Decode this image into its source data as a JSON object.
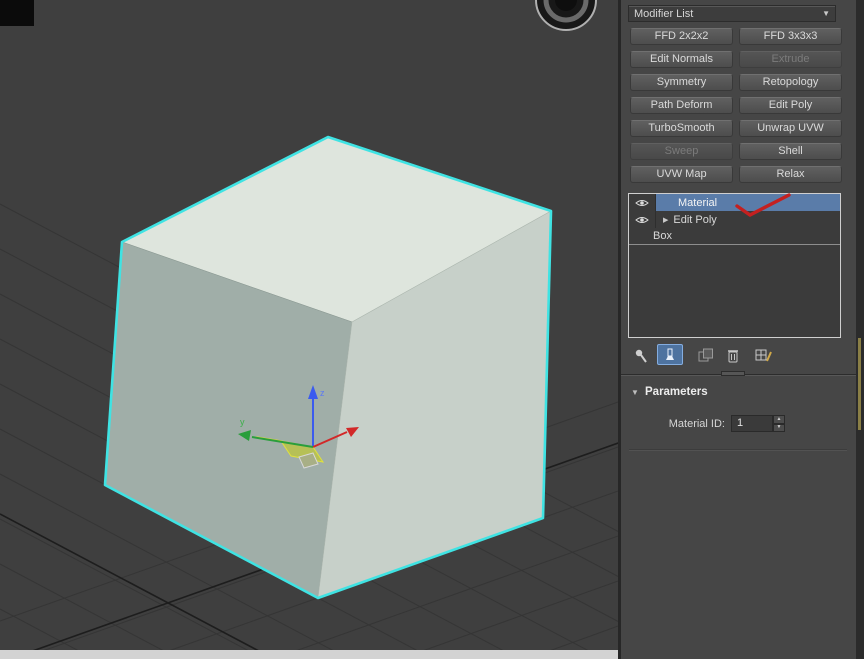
{
  "colors": {
    "selection_outline": "#3fe3e3",
    "stack_selected": "#5a7ca9",
    "annotation_check": "#c42020",
    "axis_x": "#d22828",
    "axis_y": "#2a9e3c",
    "axis_z": "#3b5bee",
    "panel_background": "#464646",
    "viewport_background": "#3f3f3f"
  },
  "viewport": {
    "object": "Box",
    "gizmo": {
      "y_label": "y",
      "z_label": "z"
    }
  },
  "modifier_panel": {
    "modifier_list_label": "Modifier List",
    "buttons": [
      {
        "label": "FFD 2x2x2",
        "enabled": true
      },
      {
        "label": "FFD 3x3x3",
        "enabled": true
      },
      {
        "label": "Edit Normals",
        "enabled": true
      },
      {
        "label": "Extrude",
        "enabled": false
      },
      {
        "label": "Symmetry",
        "enabled": true
      },
      {
        "label": "Retopology",
        "enabled": true
      },
      {
        "label": "Path Deform",
        "enabled": true
      },
      {
        "label": "Edit Poly",
        "enabled": true
      },
      {
        "label": "TurboSmooth",
        "enabled": true
      },
      {
        "label": "Unwrap UVW",
        "enabled": true
      },
      {
        "label": "Sweep",
        "enabled": false
      },
      {
        "label": "Shell",
        "enabled": true
      },
      {
        "label": "UVW Map",
        "enabled": true
      },
      {
        "label": "Relax",
        "enabled": true
      }
    ],
    "stack": [
      {
        "label": "Material",
        "selected": true,
        "visible_eye": true
      },
      {
        "label": "Edit Poly",
        "selected": false,
        "visible_eye": true
      },
      {
        "label": "Box",
        "selected": false,
        "visible_eye": false
      }
    ],
    "parameters": {
      "title": "Parameters",
      "material_id_label": "Material ID:",
      "material_id_value": "1"
    }
  }
}
